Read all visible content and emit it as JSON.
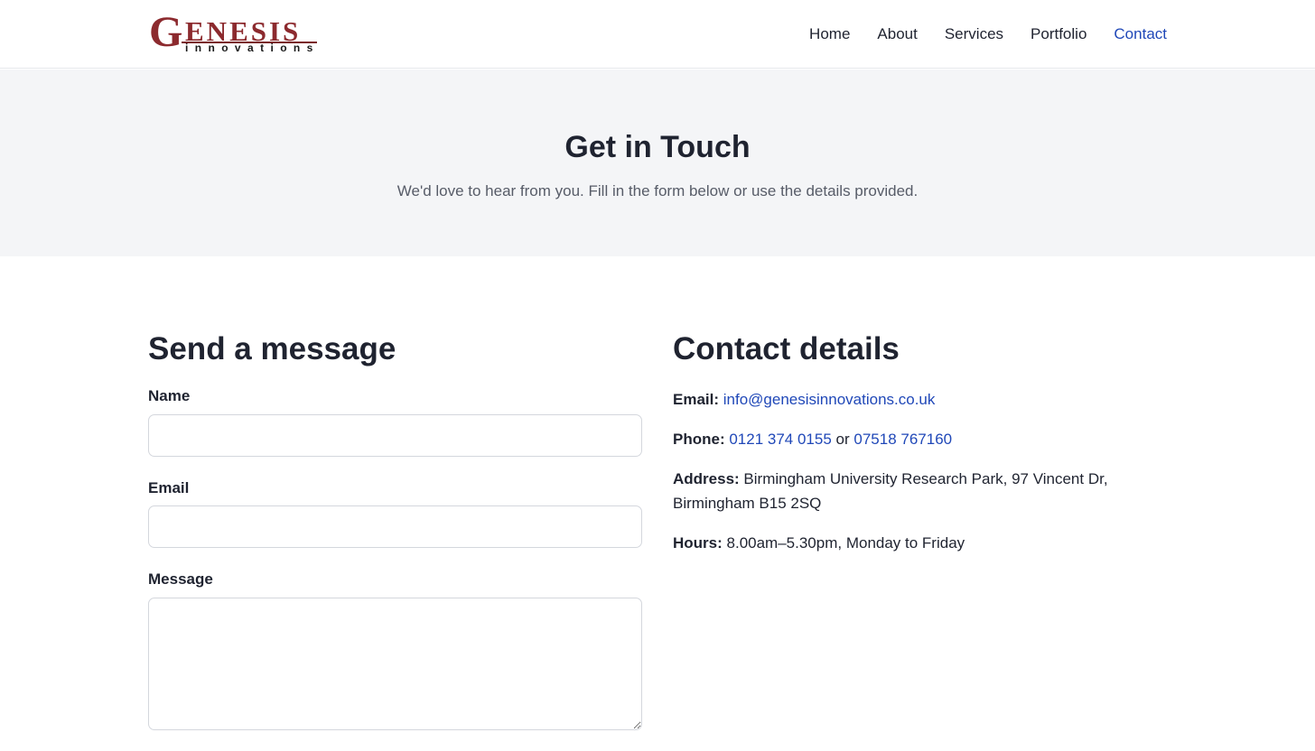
{
  "header": {
    "logo": {
      "initial": "G",
      "word": "ENESIS",
      "subtitle": "innovations"
    },
    "nav": [
      {
        "label": "Home",
        "active": false
      },
      {
        "label": "About",
        "active": false
      },
      {
        "label": "Services",
        "active": false
      },
      {
        "label": "Portfolio",
        "active": false
      },
      {
        "label": "Contact",
        "active": true
      }
    ]
  },
  "hero": {
    "title": "Get in Touch",
    "subtitle": "We'd love to hear from you. Fill in the form below or use the details provided."
  },
  "form": {
    "heading": "Send a message",
    "name_label": "Name",
    "name_value": "",
    "email_label": "Email",
    "email_value": "",
    "message_label": "Message",
    "message_value": ""
  },
  "contact": {
    "heading": "Contact details",
    "email_label": "Email:",
    "email_value": "info@genesisinnovations.co.uk",
    "phone_label": "Phone:",
    "phone_1": "0121 374 0155",
    "phone_or": "or",
    "phone_2": "07518 767160",
    "address_label": "Address:",
    "address_value": "Birmingham University Research Park, 97 Vincent Dr, Birmingham B15 2SQ",
    "hours_label": "Hours:",
    "hours_value": "8.00am–5.30pm, Monday to Friday"
  },
  "colors": {
    "brand": "#8c2a2e",
    "link": "#2048b8",
    "hero_bg": "#f4f5f7",
    "text": "#1f2330"
  }
}
